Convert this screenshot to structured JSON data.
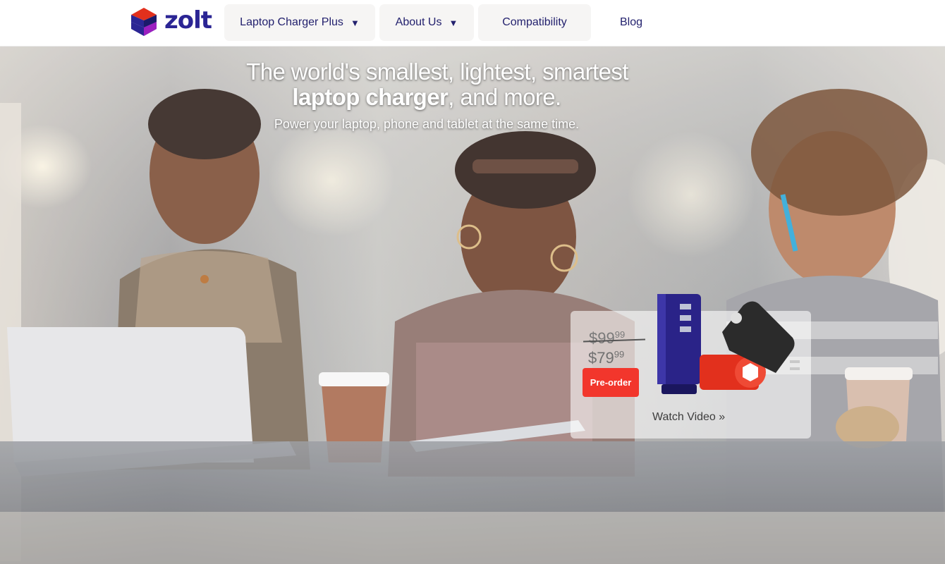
{
  "brand": {
    "name": "zolt"
  },
  "nav": {
    "items": [
      {
        "label": "Laptop Charger Plus",
        "has_dropdown": true,
        "caret": "▼"
      },
      {
        "label": "About Us",
        "has_dropdown": true,
        "caret": "▼"
      },
      {
        "label": "Compatibility",
        "has_dropdown": false
      },
      {
        "label": "Blog",
        "has_dropdown": false
      }
    ]
  },
  "hero": {
    "headline_line1": "The world's smallest, lightest, smartest",
    "headline_bold": "laptop charger",
    "headline_line2_rest": ", and more.",
    "subheadline": "Power your laptop, phone and tablet at the same time."
  },
  "promo": {
    "old_price_main": "$99",
    "old_price_cents": "99",
    "new_price_main": "$79",
    "new_price_cents": "99",
    "preorder_label": "Pre-order",
    "watch_video_label": "Watch Video »"
  },
  "colors": {
    "brand_navy": "#2b2594",
    "nav_text": "#23216e",
    "preorder_red": "#f2362c",
    "charger_blue": "#2a2388",
    "charger_red": "#e2301d",
    "charger_black": "#2b2b2b"
  }
}
